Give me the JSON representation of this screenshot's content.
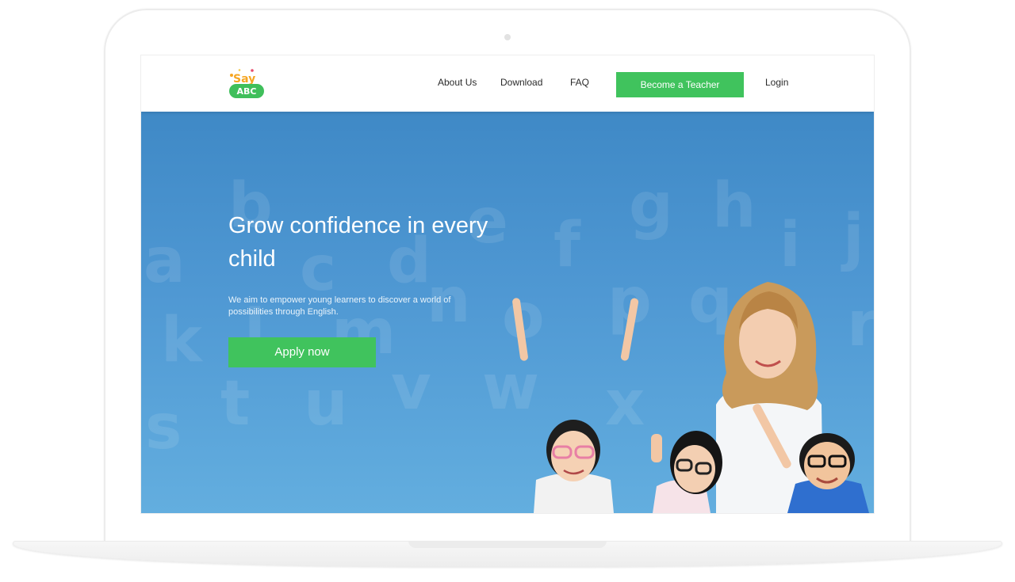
{
  "nav": {
    "about": "About Us",
    "download": "Download",
    "faq": "FAQ",
    "teacher_button": "Become a Teacher",
    "login": "Login"
  },
  "logo": {
    "line1": "Say",
    "line2": "ABC"
  },
  "hero": {
    "title": "Grow confidence in every child",
    "subtitle": "We aim to empower young learners to discover a world of possibilities through English.",
    "button": "Apply now"
  },
  "background_letters": [
    "a",
    "b",
    "c",
    "d",
    "e",
    "f",
    "g",
    "h",
    "i",
    "j",
    "k",
    "l",
    "m",
    "n",
    "o",
    "p",
    "q",
    "r",
    "s",
    "t",
    "u",
    "v",
    "w",
    "x"
  ],
  "colors": {
    "accent_green": "#40c35d",
    "hero_blue_top": "#3f89c6",
    "hero_blue_bottom": "#63aedf",
    "nav_text": "#2a2a2a"
  }
}
